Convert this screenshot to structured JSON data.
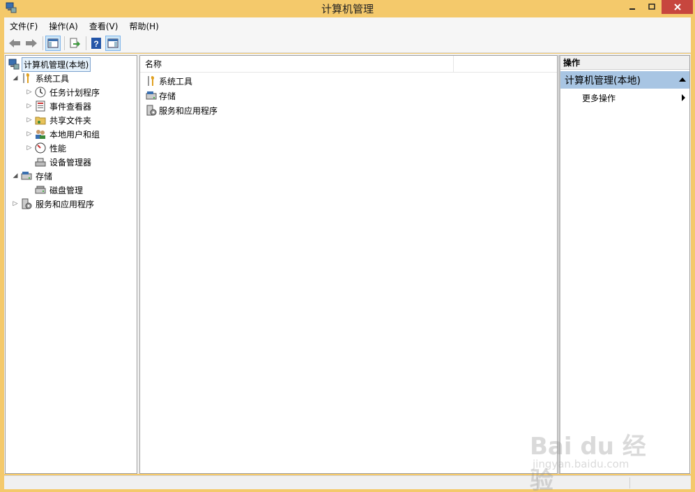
{
  "window": {
    "title": "计算机管理"
  },
  "menu": [
    "文件(F)",
    "操作(A)",
    "查看(V)",
    "帮助(H)"
  ],
  "tree": {
    "root": "计算机管理(本地)",
    "system_tools": "系统工具",
    "task_scheduler": "任务计划程序",
    "event_viewer": "事件查看器",
    "shared_folders": "共享文件夹",
    "local_users": "本地用户和组",
    "performance": "性能",
    "device_manager": "设备管理器",
    "storage": "存储",
    "disk_mgmt": "磁盘管理",
    "services_apps": "服务和应用程序"
  },
  "list": {
    "column_name": "名称",
    "items": [
      "系统工具",
      "存储",
      "服务和应用程序"
    ]
  },
  "actions": {
    "header": "操作",
    "group": "计算机管理(本地)",
    "more": "更多操作"
  },
  "watermark": {
    "main": "Bai du 经验",
    "sub": "jingyan.baidu.com"
  }
}
